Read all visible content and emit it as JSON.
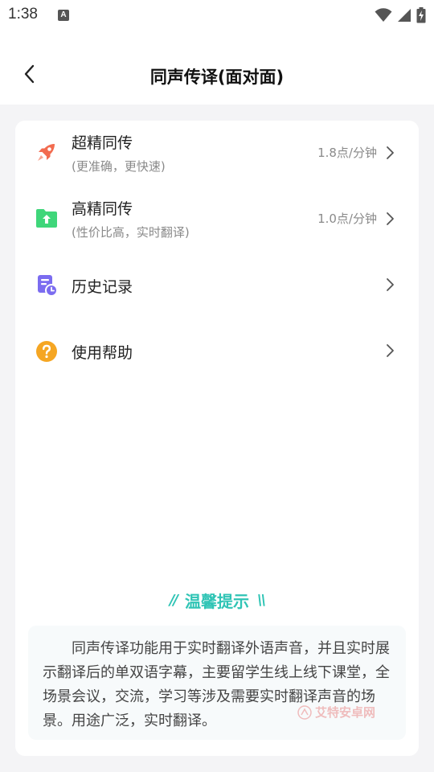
{
  "status_bar": {
    "time": "1:38",
    "notif_icon_letter": "A"
  },
  "header": {
    "title": "同声传译(面对面)"
  },
  "menu": {
    "items": [
      {
        "title": "超精同传",
        "subtitle": "(更准确，更快速)",
        "price": "1.8点/分钟",
        "icon": "rocket-icon",
        "color": "#f26b4f"
      },
      {
        "title": "高精同传",
        "subtitle": "(性价比高，实时翻译)",
        "price": "1.0点/分钟",
        "icon": "folder-upload-icon",
        "color": "#3fd67a"
      },
      {
        "title": "历史记录",
        "icon": "history-icon",
        "color": "#7b6cf0"
      },
      {
        "title": "使用帮助",
        "icon": "help-icon",
        "color": "#f5a623"
      }
    ]
  },
  "tips": {
    "title": "温馨提示",
    "text": "同声传译功能用于实时翻译外语声音，并且实时展示翻译后的单双语字幕，主要留学生线上线下课堂，全场景会议，交流，学习等涉及需要实时翻译声音的场景。用途广泛，实时翻译。",
    "accent_color": "#2fc4b5"
  },
  "watermark": {
    "text": "艾特安卓网"
  }
}
